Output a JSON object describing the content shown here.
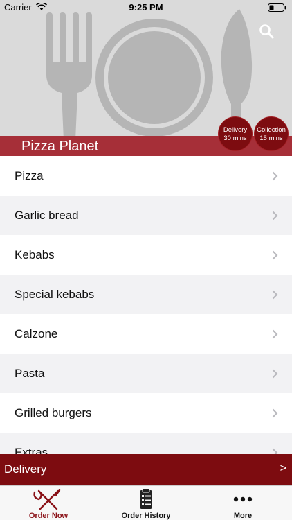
{
  "status_bar": {
    "carrier": "Carrier",
    "time": "9:25 PM"
  },
  "header": {
    "restaurant_name": "Pizza Planet"
  },
  "badges": {
    "delivery": {
      "label": "Delivery",
      "time": "30 mins"
    },
    "collection": {
      "label": "Collection",
      "time": "15 mins"
    }
  },
  "menu": {
    "categories": [
      {
        "label": "Pizza"
      },
      {
        "label": "Garlic bread"
      },
      {
        "label": "Kebabs"
      },
      {
        "label": "Special kebabs"
      },
      {
        "label": "Calzone"
      },
      {
        "label": "Pasta"
      },
      {
        "label": "Grilled burgers"
      },
      {
        "label": "Extras"
      }
    ]
  },
  "delivery_bar": {
    "label": "Delivery",
    "arrow": ">"
  },
  "tabs": [
    {
      "label": "Order Now",
      "icon": "fork-knife-icon",
      "active": true
    },
    {
      "label": "Order History",
      "icon": "clipboard-list-icon",
      "active": false
    },
    {
      "label": "More",
      "icon": "ellipsis-icon",
      "active": false
    }
  ],
  "colors": {
    "accent": "#7d0c10",
    "title_bar": "#a62f38",
    "hero_background": "#dadada",
    "active_tab": "#8a1117"
  }
}
